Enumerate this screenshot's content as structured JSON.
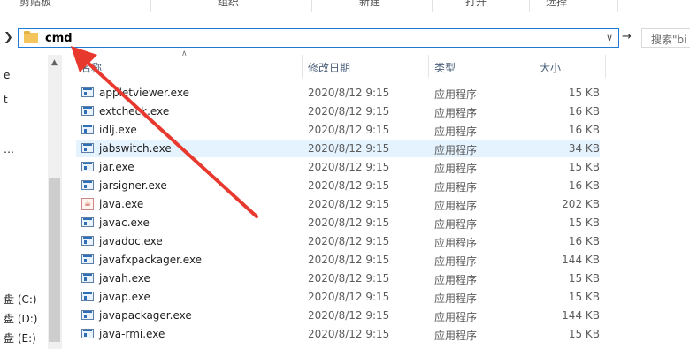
{
  "ribbon": {
    "groups": [
      "剪贴板",
      "组织",
      "新建",
      "打开",
      "选择"
    ]
  },
  "address": {
    "path": "cmd",
    "search_placeholder": "搜索\"bi"
  },
  "nav": {
    "items": [
      "e",
      "t",
      "…",
      "盘 (C:)",
      "盘 (D:)",
      "盘 (E:)"
    ]
  },
  "columns": {
    "name": "名称",
    "date": "修改日期",
    "type": "类型",
    "size": "大小"
  },
  "files": [
    {
      "name": "appletviewer.exe",
      "date": "2020/8/12 9:15",
      "type": "应用程序",
      "size": "15 KB"
    },
    {
      "name": "extcheck.exe",
      "date": "2020/8/12 9:15",
      "type": "应用程序",
      "size": "16 KB"
    },
    {
      "name": "idlj.exe",
      "date": "2020/8/12 9:15",
      "type": "应用程序",
      "size": "16 KB"
    },
    {
      "name": "jabswitch.exe",
      "date": "2020/8/12 9:15",
      "type": "应用程序",
      "size": "34 KB"
    },
    {
      "name": "jar.exe",
      "date": "2020/8/12 9:15",
      "type": "应用程序",
      "size": "15 KB"
    },
    {
      "name": "jarsigner.exe",
      "date": "2020/8/12 9:15",
      "type": "应用程序",
      "size": "16 KB"
    },
    {
      "name": "java.exe",
      "date": "2020/8/12 9:15",
      "type": "应用程序",
      "size": "202 KB"
    },
    {
      "name": "javac.exe",
      "date": "2020/8/12 9:15",
      "type": "应用程序",
      "size": "15 KB"
    },
    {
      "name": "javadoc.exe",
      "date": "2020/8/12 9:15",
      "type": "应用程序",
      "size": "16 KB"
    },
    {
      "name": "javafxpackager.exe",
      "date": "2020/8/12 9:15",
      "type": "应用程序",
      "size": "144 KB"
    },
    {
      "name": "javah.exe",
      "date": "2020/8/12 9:15",
      "type": "应用程序",
      "size": "15 KB"
    },
    {
      "name": "javap.exe",
      "date": "2020/8/12 9:15",
      "type": "应用程序",
      "size": "15 KB"
    },
    {
      "name": "javapackager.exe",
      "date": "2020/8/12 9:15",
      "type": "应用程序",
      "size": "144 KB"
    },
    {
      "name": "java-rmi.exe",
      "date": "2020/8/12 9:15",
      "type": "应用程序",
      "size": "15 KB"
    }
  ],
  "colors": {
    "selection": "#e5f3ff",
    "address_border": "#1f7ad4",
    "annotation_arrow": "#e8392f"
  }
}
